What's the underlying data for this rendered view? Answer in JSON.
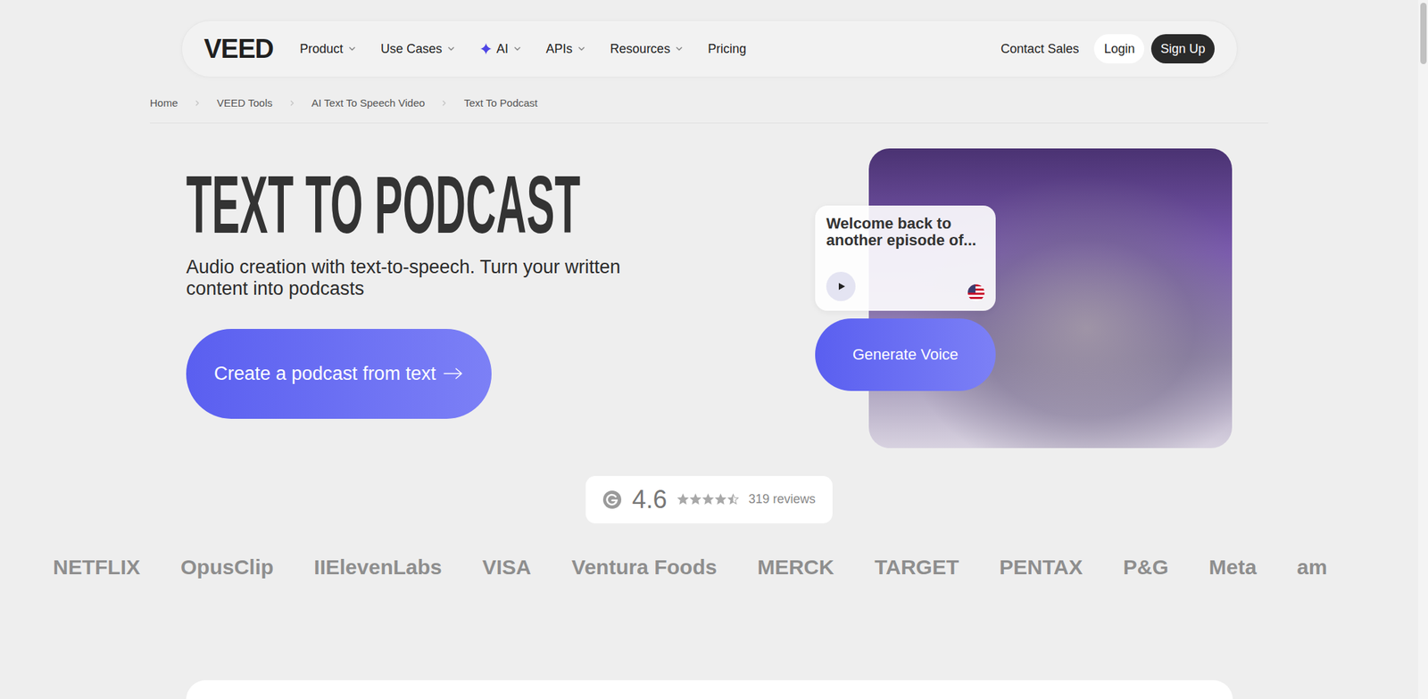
{
  "nav": {
    "logo": "VEED",
    "items": [
      {
        "label": "Product",
        "kind": "menu"
      },
      {
        "label": "Use Cases",
        "kind": "menu"
      },
      {
        "label": "AI",
        "kind": "ai"
      },
      {
        "label": "APIs",
        "kind": "menu"
      },
      {
        "label": "Resources",
        "kind": "menu"
      },
      {
        "label": "Pricing",
        "kind": "link"
      }
    ],
    "contact": "Contact Sales",
    "login": "Login",
    "signup": "Sign Up"
  },
  "breadcrumb": [
    "Home",
    "VEED Tools",
    "AI Text To Speech Video",
    "Text To Podcast"
  ],
  "hero": {
    "title": "TEXT TO PODCAST",
    "subtitle": "Audio creation with text-to-speech. Turn your written content into podcasts",
    "cta": "Create a podcast from text"
  },
  "preview": {
    "caption": "Welcome back to another episode of...",
    "button": "Generate Voice"
  },
  "rating": {
    "score": "4.6",
    "stars": 4.5,
    "reviews": "319 reviews"
  },
  "logos": [
    "NETFLIX",
    "OpusClip",
    "IIElevenLabs",
    "VISA",
    "Ventura Foods",
    "MERCK",
    "TARGET",
    "PENTAX",
    "P&G",
    "Meta",
    "am"
  ]
}
